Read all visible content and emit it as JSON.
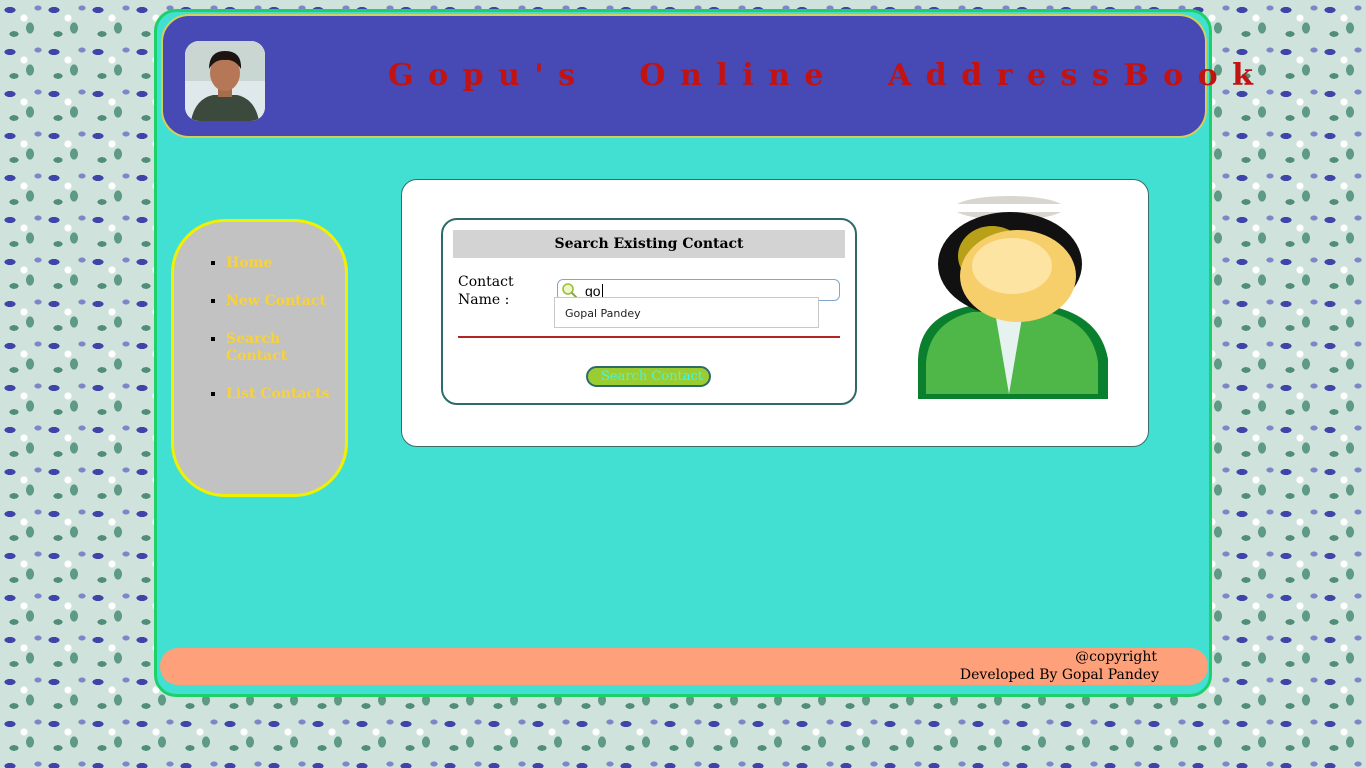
{
  "header": {
    "title": "Gopu's  Online  AddressBook",
    "avatar_alt": "profile photo"
  },
  "nav": {
    "items": [
      {
        "label": "Home"
      },
      {
        "label": "New Contact"
      },
      {
        "label": "Search Contact"
      },
      {
        "label": "List Contacts"
      }
    ]
  },
  "search_form": {
    "heading": "Search Existing Contact",
    "field_label": "Contact Name :",
    "input_value": "go",
    "suggestions": [
      "Gopal Pandey"
    ],
    "submit_label": "Search Contact"
  },
  "footer": {
    "copyright": "@copyright",
    "developer": "Developed By Gopal Pandey"
  },
  "colors": {
    "header_bg": "#4749b5",
    "title": "#c21212",
    "frame_bg": "#41e0d2",
    "nav_bg": "#c2c2c2",
    "nav_link": "#f8d23a",
    "nav_border": "#f0f000",
    "button_bg": "#9acd32",
    "button_text": "#40f7f0",
    "footer_bg": "#fea07a"
  }
}
